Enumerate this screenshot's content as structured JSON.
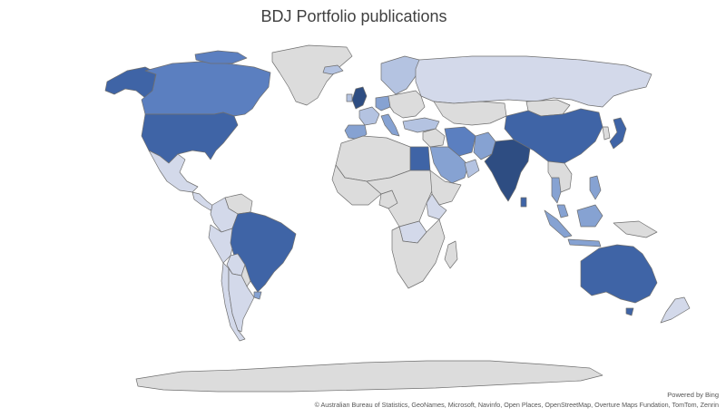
{
  "title": "BDJ Portfolio publications",
  "attribution": {
    "powered_by": "Powered by Bing",
    "credits": "© Australian Bureau of Statistics, GeoNames, Microsoft, Navinfo, Open Places, OpenStreetMap, Overture Maps Fundation, TomTom, Zenrin"
  },
  "colors": {
    "no_data": "#dcdcdc",
    "level_1": "#d3d9ea",
    "level_2": "#b4c3e1",
    "level_3": "#86a2d2",
    "level_4": "#5b7fc0",
    "level_5": "#3f64a6",
    "level_6": "#2e4d82",
    "border": "#6f6f6f"
  },
  "shading_levels": {
    "united-kingdom": 6,
    "united-states": 5,
    "india": 6,
    "canada": 4,
    "alaska": 5,
    "brazil": 5,
    "australia": 5,
    "china": 5,
    "japan": 5,
    "egypt": 5,
    "iran": 4,
    "pakistan": 3,
    "saudi-arabia": 3,
    "russia": 1,
    "mexico": 1,
    "colombia": 1,
    "peru": 1,
    "chile": 1,
    "argentina": 1,
    "bolivia": 1,
    "kenya": 1,
    "zambia": 1,
    "nigeria": 0,
    "indonesia": 3,
    "malaysia": 3,
    "thailand": 3,
    "new-zealand": 1,
    "turkey": 2,
    "germany": 3,
    "italy": 3,
    "spain": 3,
    "france": 2,
    "scandinavia": 2,
    "uae": 2,
    "greenland": 0,
    "africa": 0,
    "central-asia": 0,
    "middle-east": 0,
    "venezuela": 0,
    "southeast-asia": 0,
    "mongolia": 0,
    "eastern-europe": 0,
    "antarctica": 0,
    "uruguay": 3,
    "philippines": 3,
    "sri-lanka": 5
  }
}
